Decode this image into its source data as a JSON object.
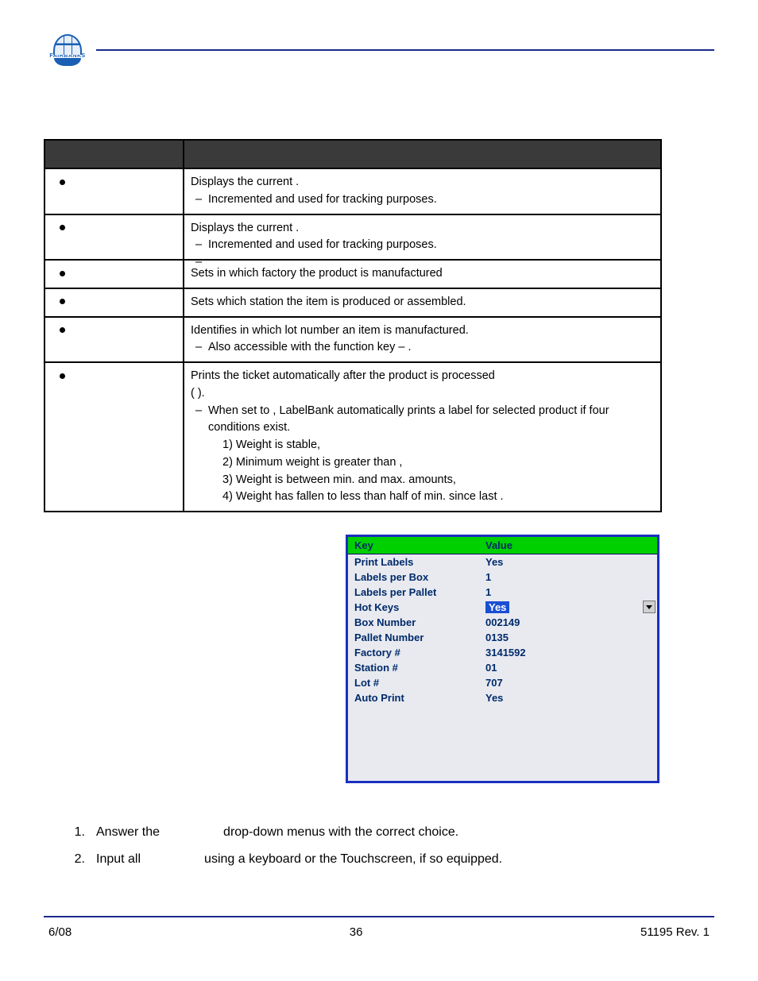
{
  "logo_text": "FAIRBANKS",
  "def_table": {
    "rows": [
      {
        "desc_lines": [
          "Displays the current                                            .",
          "<sub>Incremented and used for tracking purposes.</sub>"
        ]
      },
      {
        "desc_lines": [
          "Displays the current                                            .",
          "<sub>Incremented and used for tracking purposes.</sub>",
          "<sub> </sub>"
        ]
      },
      {
        "desc_lines": [
          "Sets in which factory the product is manufactured"
        ]
      },
      {
        "desc_lines": [
          "Sets which station the item is produced or assembled."
        ]
      },
      {
        "desc_lines": [
          "Identifies in which lot number an item is manufactured.",
          "<sub>Also accessible with the        function key –                     .</sub>"
        ]
      },
      {
        "desc_lines": [
          "Prints the ticket automatically after the product is processed",
          "    (                                                                                               ).",
          "<sub>When set to        , LabelBank automatically prints a label for selected product if four conditions exist.</sub>",
          "<num>1)  Weight is stable,</num>",
          "<num>2)  Minimum weight is greater than                ,</num>",
          "<num>3)  Weight is between min. and max. amounts,</num>",
          "<num>4)  Weight has fallen to less than half of min. since last                      .</num>"
        ]
      }
    ]
  },
  "kv_panel": {
    "head_key": "Key",
    "head_val": "Value",
    "rows": [
      {
        "key": "Print Labels",
        "val": "Yes"
      },
      {
        "key": "Labels per Box",
        "val": "1"
      },
      {
        "key": "Labels per Pallet",
        "val": "1"
      },
      {
        "key": "Hot Keys",
        "val": "Yes",
        "dropdown": true,
        "selected": true
      },
      {
        "key": "Box Number",
        "val": "002149"
      },
      {
        "key": "Pallet Number",
        "val": "0135"
      },
      {
        "key": "Factory #",
        "val": "3141592"
      },
      {
        "key": "Station #",
        "val": "01"
      },
      {
        "key": "Lot #",
        "val": "707"
      },
      {
        "key": "Auto Print",
        "val": "Yes"
      }
    ]
  },
  "instructions": [
    {
      "n": "1.",
      "pre": "Answer the",
      "post": "drop-down menus with the correct choice."
    },
    {
      "n": "2.",
      "pre": "Input all",
      "post": "using a keyboard or the Touchscreen, if so equipped."
    }
  ],
  "footer": {
    "left": "6/08",
    "center": "36",
    "right": "51195    Rev. 1"
  }
}
